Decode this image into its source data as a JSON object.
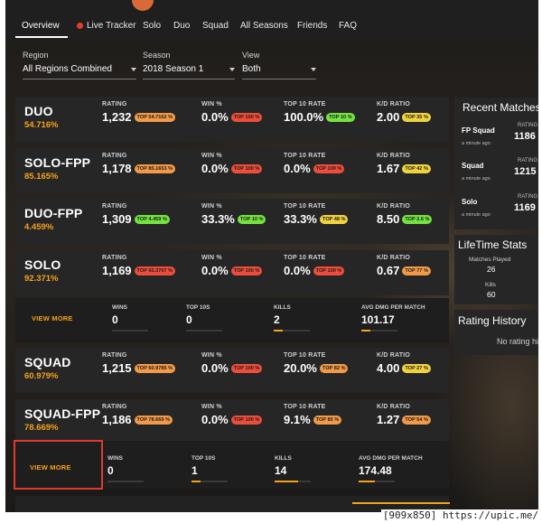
{
  "nav": {
    "tabs": [
      {
        "label": "Overview"
      },
      {
        "label": "Live Tracker"
      },
      {
        "label": "Solo"
      },
      {
        "label": "Duo"
      },
      {
        "label": "Squad"
      },
      {
        "label": "All Seasons"
      },
      {
        "label": "Friends"
      },
      {
        "label": "FAQ"
      }
    ]
  },
  "filters": {
    "region": {
      "label": "Region",
      "value": "All Regions Combined"
    },
    "season": {
      "label": "Season",
      "value": "2018 Season 1"
    },
    "view": {
      "label": "View",
      "value": "Both"
    }
  },
  "labels": {
    "rating": "RATING",
    "win": "WIN %",
    "top10": "TOP 10 RATE",
    "kd": "K/D RATIO",
    "wins": "WINS",
    "top10s": "TOP 10S",
    "kills": "KILLS",
    "avgdmg": "AVG DMG PER MATCH",
    "view_more": "VIEW MORE"
  },
  "modes": [
    {
      "name": "DUO",
      "pct": "54.716%",
      "rating": "1,232",
      "rating_badge": "TOP 54.7162 %",
      "win": "0.0%",
      "win_badge": "TOP 100 %",
      "top10": "100.0%",
      "top10_badge": "TOP 10 %",
      "kd": "2.00",
      "kd_badge": "TOP 35 %"
    },
    {
      "name": "SOLO-FPP",
      "pct": "85.165%",
      "rating": "1,178",
      "rating_badge": "TOP 85.1653 %",
      "win": "0.0%",
      "win_badge": "TOP 100 %",
      "top10": "0.0%",
      "top10_badge": "TOP 100 %",
      "kd": "1.67",
      "kd_badge": "TOP 42 %"
    },
    {
      "name": "DUO-FPP",
      "pct": "4.459%",
      "rating": "1,309",
      "rating_badge": "TOP 4.459 %",
      "win": "33.3%",
      "win_badge": "TOP 10 %",
      "top10": "33.3%",
      "top10_badge": "TOP 48 %",
      "kd": "8.50",
      "kd_badge": "TOP 2.6 %"
    },
    {
      "name": "SOLO",
      "pct": "92.371%",
      "rating": "1,169",
      "rating_badge": "TOP 92.3707 %",
      "win": "0.0%",
      "win_badge": "TOP 100 %",
      "top10": "0.0%",
      "top10_badge": "TOP 100 %",
      "kd": "0.67",
      "kd_badge": "TOP 77 %"
    },
    {
      "name": "SQUAD",
      "pct": "60.979%",
      "rating": "1,215",
      "rating_badge": "TOP 60.9785 %",
      "win": "0.0%",
      "win_badge": "TOP 100 %",
      "top10": "20.0%",
      "top10_badge": "TOP 82 %",
      "kd": "4.00",
      "kd_badge": "TOP 27 %"
    },
    {
      "name": "SQUAD-FPP",
      "pct": "78.669%",
      "rating": "1,186",
      "rating_badge": "TOP 78.669 %",
      "win": "0.0%",
      "win_badge": "TOP 100 %",
      "top10": "9.1%",
      "top10_badge": "TOP 85 %",
      "kd": "1.27",
      "kd_badge": "TOP 54 %"
    }
  ],
  "expanded": [
    {
      "wins": "0",
      "top10s": "0",
      "kills": "2",
      "avgdmg": "101.17",
      "wins_fill": 0,
      "top10s_fill": 0,
      "kills_fill": 0.25,
      "avgdmg_fill": 0.25
    },
    {
      "wins": "0",
      "top10s": "1",
      "kills": "14",
      "avgdmg": "174.48",
      "wins_fill": 0,
      "top10s_fill": 0.25,
      "kills_fill": 0.65,
      "avgdmg_fill": 0.45
    }
  ],
  "recent": {
    "title": "Recent Matches",
    "items": [
      {
        "mode": "FP Squad",
        "ago": "a minute ago",
        "rating_label": "RATING",
        "rating": "1186"
      },
      {
        "mode": "Squad",
        "ago": "a minute ago",
        "rating_label": "RATING",
        "rating": "1215"
      },
      {
        "mode": "Solo",
        "ago": "a minute ago",
        "rating_label": "RATING",
        "rating": "1169"
      }
    ]
  },
  "lifetime": {
    "title": "LifeTime Stats",
    "matches_label": "Matches Played",
    "matches": "26",
    "kills_label": "Kills",
    "kills": "60"
  },
  "rating_history": {
    "title": "Rating History",
    "empty": "No rating his"
  },
  "watermark": "[909x850] https://upic.me/",
  "colors": {
    "accent": "#f5a31a",
    "badge_red": "#ef4d3b",
    "badge_orange": "#f29a47",
    "badge_yellow": "#efd33e",
    "badge_green": "#73e33f",
    "highlight_box": "#e03a2e"
  }
}
